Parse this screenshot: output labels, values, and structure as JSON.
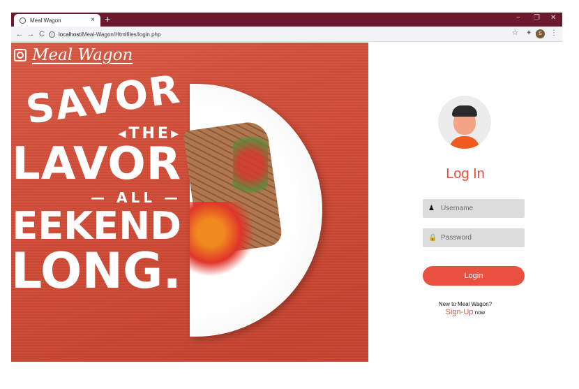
{
  "browser": {
    "tab_title": "Meal Wagon",
    "tab_close": "×",
    "new_tab": "+",
    "url_host": "localhost",
    "url_path": "/Meal-Wagon/Htmlfiles/login.php",
    "back": "←",
    "forward": "→",
    "reload": "C",
    "bookmark_star": "☆",
    "extensions": "✦",
    "profile_initial": "S",
    "menu": "⋮",
    "minimize": "−",
    "restore": "❐",
    "close": "✕"
  },
  "hero": {
    "brand": "Meal Wagon",
    "slogan": [
      "SAVOR",
      "◂THE▸",
      "FLAVOR",
      "— ALL —",
      "WEEKEND",
      "◣LONG."
    ]
  },
  "login": {
    "title": "Log In",
    "username_placeholder": "Username",
    "password_placeholder": "Password",
    "login_button": "Login",
    "new_text": "New to Meal Wagon?",
    "signup_link": "Sign-Up",
    "signup_suffix": "now"
  },
  "colors": {
    "accent": "#e94e3f",
    "tabbar": "#6b1a2b"
  }
}
